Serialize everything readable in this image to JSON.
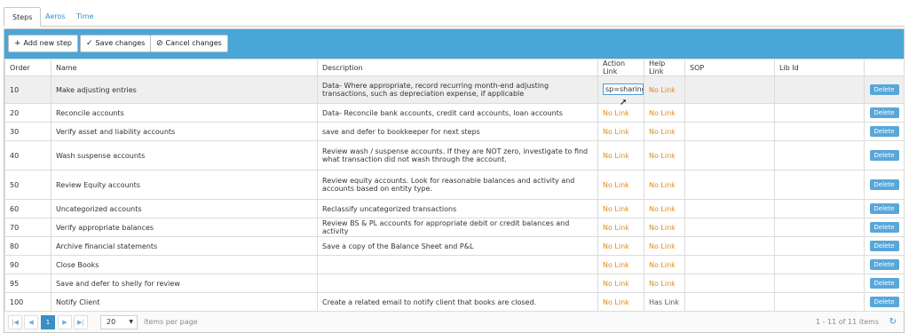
{
  "tabs": [
    {
      "label": "Steps",
      "active": true
    },
    {
      "label": "Aeros",
      "active": false
    },
    {
      "label": "Time",
      "active": false
    }
  ],
  "toolbar": {
    "add_label": "Add new step",
    "save_label": "Save changes",
    "cancel_label": "Cancel changes"
  },
  "columns": {
    "order": "Order",
    "name": "Name",
    "description": "Description",
    "action_link": "Action Link",
    "help_link": "Help Link",
    "sop": "SOP",
    "lib_id": "Lib Id"
  },
  "rows": [
    {
      "order": "10",
      "name": "Make adjusting entries",
      "description": "Data- Where appropriate, record recurring month-end adjusting transactions, such as depreciation expense, if applicable",
      "action_link": "sp=sharing",
      "help_link": "No Link",
      "sop": "",
      "lib_id": "",
      "delete": "Delete"
    },
    {
      "order": "20",
      "name": "Reconcile accounts",
      "description": "Data- Reconcile bank accounts, credit card accounts, loan accounts",
      "action_link": "No Link",
      "help_link": "No Link",
      "sop": "",
      "lib_id": "",
      "delete": "Delete"
    },
    {
      "order": "30",
      "name": "Verify asset and liability accounts",
      "description": "save and defer to bookkeeper for next steps",
      "action_link": "No Link",
      "help_link": "No Link",
      "sop": "",
      "lib_id": "",
      "delete": "Delete"
    },
    {
      "order": "40",
      "name": "Wash suspense accounts",
      "description": "Review wash / suspense accounts. If they are NOT zero, investigate to find what transaction did not wash through the account.",
      "action_link": "No Link",
      "help_link": "No Link",
      "sop": "",
      "lib_id": "",
      "delete": "Delete"
    },
    {
      "order": "50",
      "name": "Review Equity accounts",
      "description": "Review equity accounts. Look for reasonable balances and activity and accounts based on entity type.",
      "action_link": "No Link",
      "help_link": "No Link",
      "sop": "",
      "lib_id": "",
      "delete": "Delete"
    },
    {
      "order": "60",
      "name": "Uncategorized accounts",
      "description": "Reclassify uncategorized transactions",
      "action_link": "No Link",
      "help_link": "No Link",
      "sop": "",
      "lib_id": "",
      "delete": "Delete"
    },
    {
      "order": "70",
      "name": "Verify appropriate balances",
      "description": "Review BS & PL accounts for appropriate debit or credit balances and activity",
      "action_link": "No Link",
      "help_link": "No Link",
      "sop": "",
      "lib_id": "",
      "delete": "Delete"
    },
    {
      "order": "80",
      "name": "Archive financial statements",
      "description": "Save a copy of the Balance Sheet and P&L",
      "action_link": "No Link",
      "help_link": "No Link",
      "sop": "",
      "lib_id": "",
      "delete": "Delete"
    },
    {
      "order": "90",
      "name": "Close Books",
      "description": "",
      "action_link": "No Link",
      "help_link": "No Link",
      "sop": "",
      "lib_id": "",
      "delete": "Delete"
    },
    {
      "order": "95",
      "name": "Save and defer to shelly for review",
      "description": "",
      "action_link": "No Link",
      "help_link": "No Link",
      "sop": "",
      "lib_id": "",
      "delete": "Delete"
    },
    {
      "order": "100",
      "name": "Notify Client",
      "description": "Create a related email to notify client that books are closed.",
      "action_link": "No Link",
      "help_link": "Has Link",
      "sop": "",
      "lib_id": "",
      "delete": "Delete"
    }
  ],
  "pager": {
    "current_page": "1",
    "page_size": "20",
    "items_per_page_label": "items per page",
    "info": "1 - 11 of 11 items"
  },
  "colors": {
    "toolbar_bg": "#4aa6d6",
    "no_link": "#e08a1e",
    "delete_bg": "#59a7d9",
    "tab_link": "#3a8fc4"
  }
}
